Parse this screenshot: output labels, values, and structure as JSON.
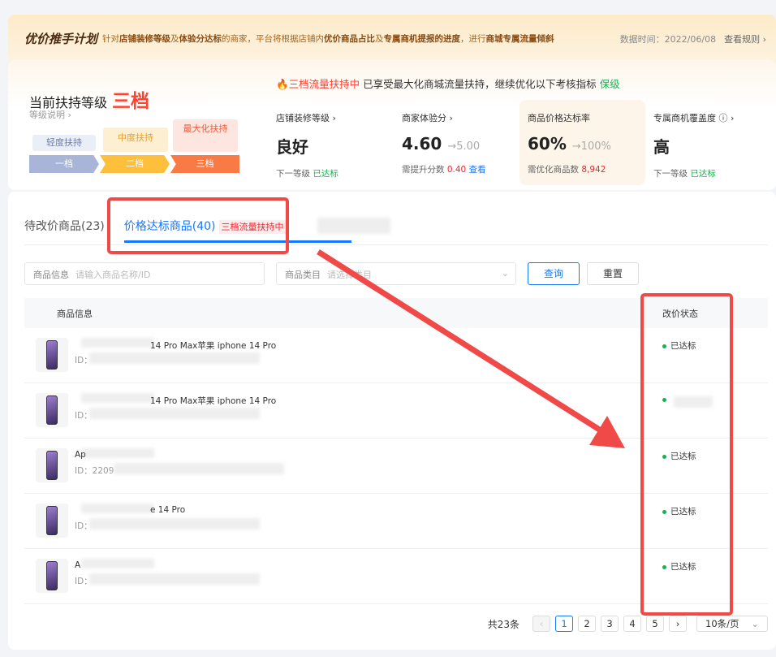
{
  "banner": {
    "logo": "优价推手计划",
    "desc_parts": [
      "针对",
      "店铺装修等级",
      "及",
      "体验分达标",
      "的商家，平台将根据店铺内",
      "优价商品占比",
      "及",
      "专属商机提报的进度",
      "，进行",
      "商城专属流量倾斜"
    ],
    "data_time": "数据时间：2022/06/08",
    "rules_link": "查看规则 ›"
  },
  "level": {
    "label": "当前扶持等级",
    "value": "三档",
    "desc": "等级说明 ›",
    "steps": [
      {
        "top": "轻度扶持",
        "bar": "一档"
      },
      {
        "top": "中度扶持",
        "bar": "二档"
      },
      {
        "top": "最大化扶持",
        "bar": "三档"
      }
    ]
  },
  "notice": {
    "highlight": "三档流量扶持中",
    "text": "已享受最大化商城流量扶持，继续优化以下考核指标",
    "keep": "保级"
  },
  "metrics": [
    {
      "title": "店铺装修等级 ›",
      "value": "良好",
      "target": "",
      "sub": "下一等级",
      "sub_val": "已达标"
    },
    {
      "title": "商家体验分 ›",
      "value": "4.60",
      "target": "→5.00",
      "sub": "需提升分数",
      "sub_val": "0.40",
      "sub_link": "查看"
    },
    {
      "title": "商品价格达标率",
      "value": "60%",
      "target": "→100%",
      "sub": "需优化商品数",
      "sub_val": "8,942"
    },
    {
      "title": "专属商机覆盖度 ⓘ ›",
      "value": "高",
      "target": "",
      "sub": "下一等级",
      "sub_val": "已达标"
    }
  ],
  "tabs": [
    {
      "label": "待改价商品(23)"
    },
    {
      "label": "价格达标商品(40)",
      "badge": "三档流量扶持中",
      "active": true
    }
  ],
  "filters": {
    "info_label": "商品信息",
    "info_placeholder": "请输入商品名称/ID",
    "cat_label": "商品类目",
    "cat_placeholder": "请选择类目",
    "query": "查询",
    "reset": "重置"
  },
  "table": {
    "headers": [
      "商品信息",
      "改价状态"
    ],
    "rows": [
      {
        "name": "14 Pro Max苹果 iphone 14 Pro",
        "id": "ID：",
        "status": "已达标"
      },
      {
        "name": "14 Pro Max苹果 iphone 14 Pro",
        "id": "ID：",
        "status": ""
      },
      {
        "name": "Ap",
        "id": "ID：2209",
        "status": "已达标"
      },
      {
        "name": "e 14 Pro",
        "id": "ID：",
        "status": "已达标"
      },
      {
        "name": "A",
        "id": "ID：",
        "status": "已达标"
      }
    ]
  },
  "pagination": {
    "total": "共23条",
    "pages": [
      "1",
      "2",
      "3",
      "4",
      "5"
    ],
    "current": "1",
    "page_size": "10条/页"
  },
  "colors": {
    "accent": "#1677ff",
    "danger": "#ff3b30",
    "success": "#1cb052",
    "annotation": "#f04a48"
  }
}
